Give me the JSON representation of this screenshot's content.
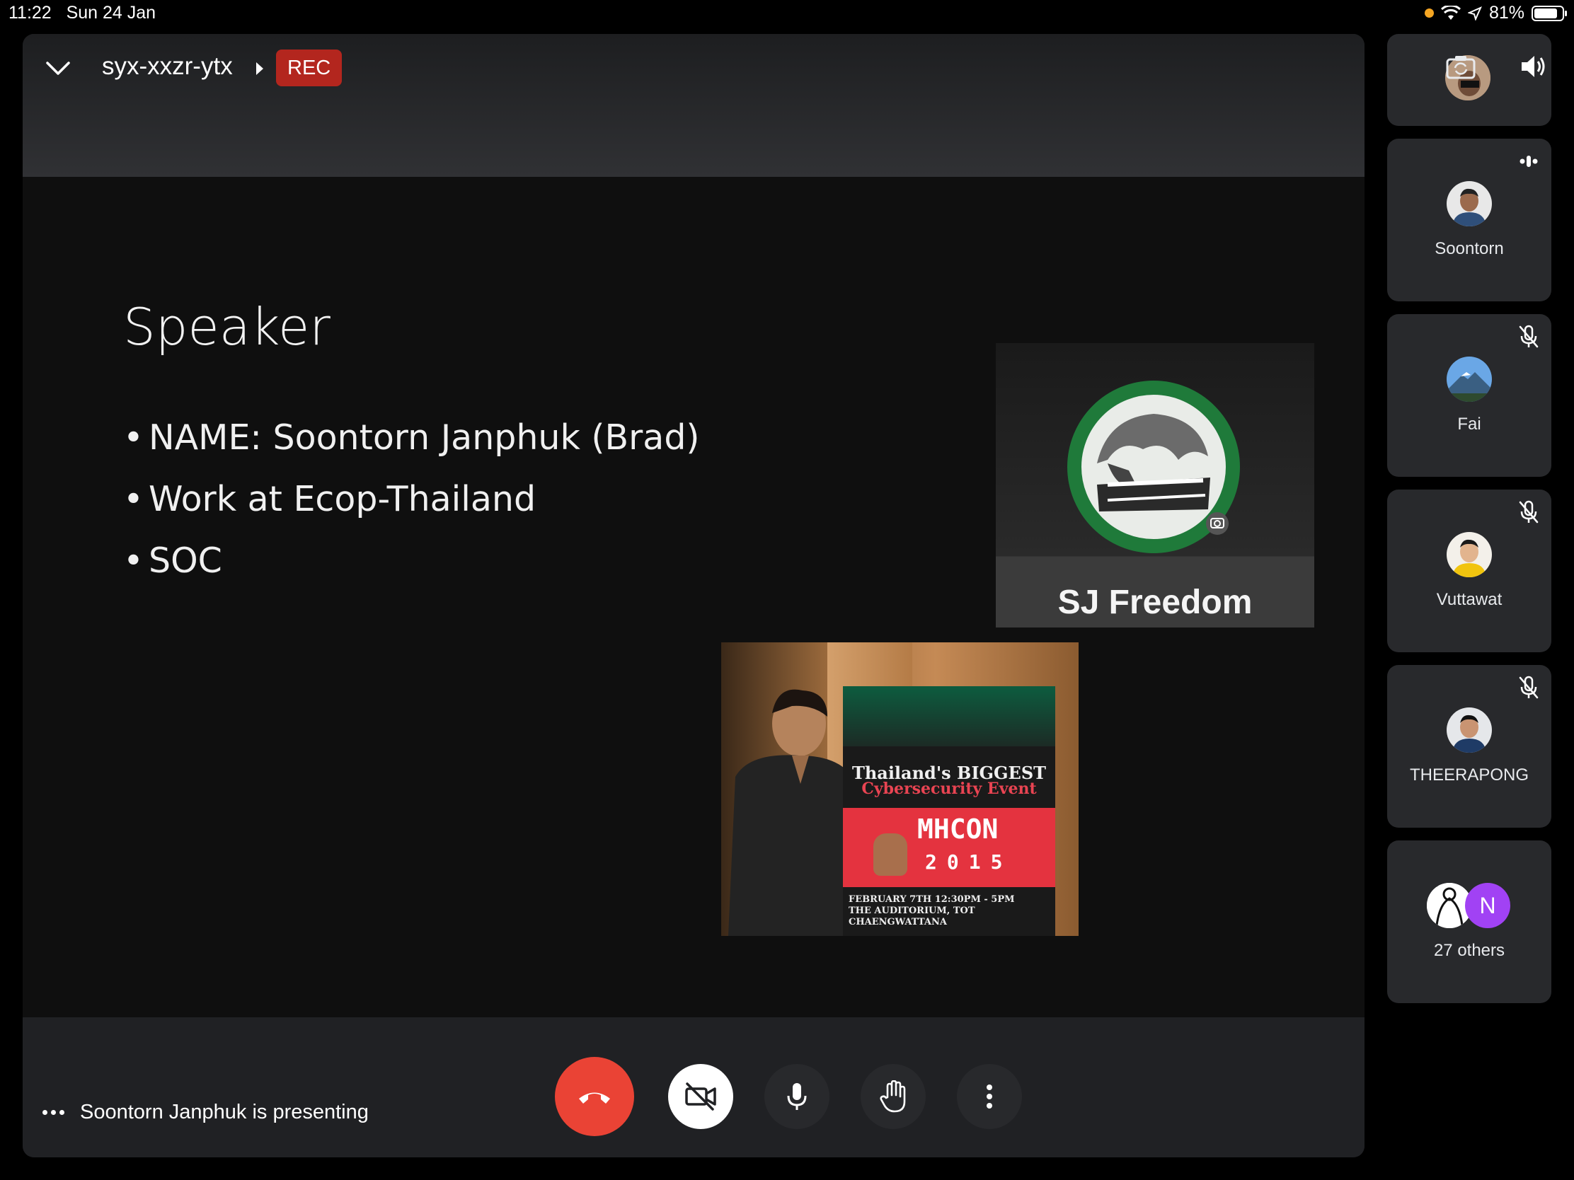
{
  "status_bar": {
    "time": "11:22",
    "date": "Sun 24 Jan",
    "battery": "81%"
  },
  "meeting": {
    "code": "syx-xxzr-ytx",
    "rec_label": "REC",
    "presenting_text": "Soontorn Janphuk is presenting"
  },
  "slide": {
    "title": "Speaker",
    "bullets": [
      "NAME: Soontorn Janphuk (Brad)",
      "Work at Ecop-Thailand",
      "SOC"
    ],
    "logo_name": "SJ Freedom",
    "poster": {
      "line1": "Thailand's BIGGEST",
      "line2": "Cybersecurity Event",
      "brand": "MHCON",
      "year": "2015",
      "date_line": "FEBRUARY 7TH 12:30PM - 5PM",
      "venue_line": "THE AUDITORIUM, TOT CHAENGWATTANA"
    }
  },
  "participants": [
    {
      "name": "Soontorn",
      "status_icon": "speaking-icon"
    },
    {
      "name": "Fai",
      "status_icon": "mic-off-icon"
    },
    {
      "name": "Vuttawat",
      "status_icon": "mic-off-icon"
    },
    {
      "name": "THEERAPONG",
      "status_icon": "mic-off-icon"
    }
  ],
  "others": {
    "label": "27 others",
    "avatar_letter": "N"
  },
  "colors": {
    "end_call": "#ea4335",
    "rec": "#b3261e",
    "tile_bg": "#28292c",
    "stage_bg": "#202124",
    "others_avatar": "#a142f4"
  }
}
